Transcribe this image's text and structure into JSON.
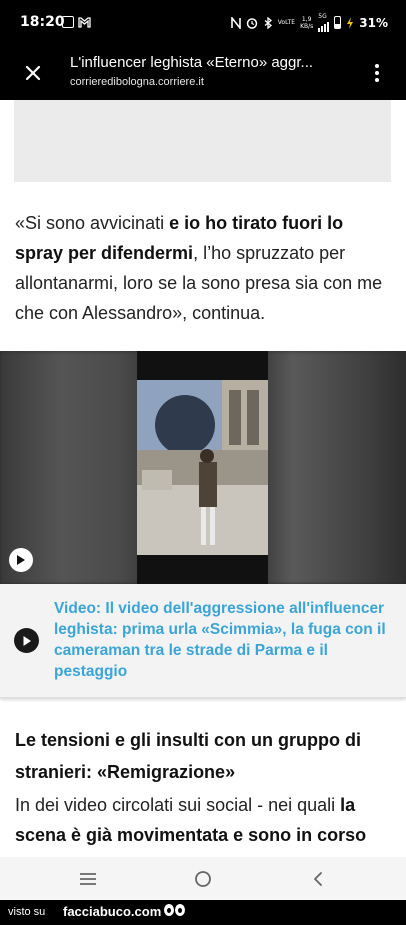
{
  "status_bar": {
    "time": "18:20",
    "volte_label": "VoLTE",
    "speed_value": "1,9",
    "speed_unit": "KB/s",
    "network": "5G",
    "battery": "31%"
  },
  "app_bar": {
    "title": "L'influencer leghista «Eterno» aggr...",
    "domain": "corrieredibologna.corriere.it"
  },
  "article": {
    "para1": {
      "pre": "«Si sono avvicinati ",
      "bold": "e io ho tirato fuori lo spray per difendermi",
      "post": ", l’ho spruzzato per allontanarmi, loro se la sono presa sia con me che con Alessandro», continua."
    },
    "video_caption": "Video: Il video dell'aggressione all'influencer leghista: prima urla «Scimmia», la fuga con il cameraman tra le strade di Parma e il pestaggio",
    "subhead": "Le tensioni e gli insulti con un gruppo di stranieri: «Remigrazione»",
    "para2": {
      "pre": "In dei video circolati sui social - nei quali ",
      "bold": "la scena è già movimentata e sono in corso",
      "post": ""
    }
  },
  "watermark": {
    "prefix": "visto su",
    "site": "facciabuco.com"
  },
  "icons": {
    "close": "close-icon",
    "menu": "more-vert-icon",
    "play": "play-icon",
    "nav_recent": "menu-lines-icon",
    "nav_home": "circle-icon",
    "nav_back": "chevron-left-icon"
  }
}
